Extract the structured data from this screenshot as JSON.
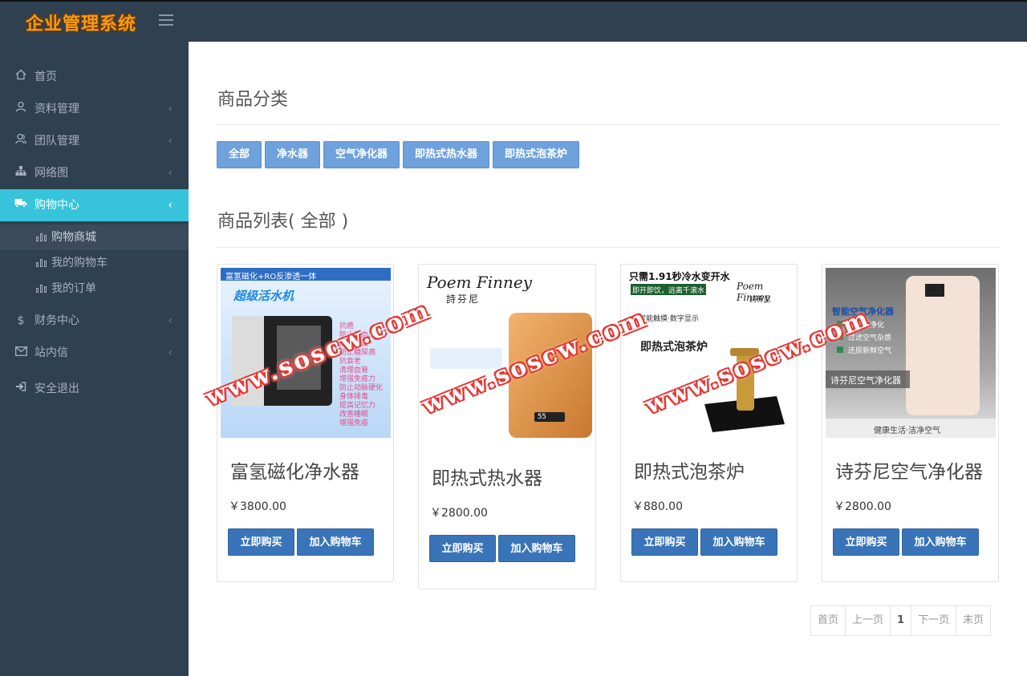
{
  "app": {
    "logo_text": "企业管理系统"
  },
  "sidebar": {
    "items": [
      {
        "label": "首页",
        "icon": "home-icon"
      },
      {
        "label": "资料管理",
        "icon": "user-icon"
      },
      {
        "label": "团队管理",
        "icon": "team-icon"
      },
      {
        "label": "网络图",
        "icon": "sitemap-icon"
      },
      {
        "label": "购物中心",
        "icon": "truck-icon",
        "active": true
      },
      {
        "label": "财务中心",
        "icon": "dollar-icon"
      },
      {
        "label": "站内信",
        "icon": "mail-icon"
      },
      {
        "label": "安全退出",
        "icon": "logout-icon"
      }
    ],
    "sub_items": [
      {
        "label": "购物商城",
        "active": true
      },
      {
        "label": "我的购物车"
      },
      {
        "label": "我的订单"
      }
    ]
  },
  "main": {
    "category_title": "商品分类",
    "categories": [
      "全部",
      "净水器",
      "空气净化器",
      "即热式热水器",
      "即热式泡茶炉"
    ],
    "list_title": "商品列表( 全部 )",
    "products": [
      {
        "name": "富氢磁化净水器",
        "price": "￥3800.00",
        "img_header": "富氢磁化+RO反渗透一体",
        "img_brand": "超级活水机",
        "img_features": [
          "抗癌",
          "防止高血压",
          "消除色斑",
          "防止糖尿病",
          "抗衰老",
          "清理血管",
          "增强免疫力",
          "防止动脉硬化",
          "身体排毒",
          "提高记忆力",
          "改善睡眠",
          "增强免疫"
        ]
      },
      {
        "name": "即热式热水器",
        "price": "￥2800.00",
        "img_brand": "Poem Finney",
        "img_brand_cn": "詩芬尼",
        "img_display": "55"
      },
      {
        "name": "即热式泡茶炉",
        "price": "￥880.00",
        "img_header": "只需1.91秒冷水变开水",
        "img_sub": "即开即饮，远离千滚水",
        "img_brand": "Poem Finney",
        "img_brand_cn": "詩芬尼",
        "img_feature": "智能触摸·数字显示",
        "img_product_title": "即热式泡茶炉"
      },
      {
        "name": "诗芬尼空气净化器",
        "price": "￥2800.00",
        "img_header": "智能空气净化器",
        "img_features": [
          "多元化净化",
          "过滤空气杂质",
          "还原新鲜空气"
        ],
        "img_label": "诗芬尼空气净化器",
        "img_footer": "健康生活·洁净空气"
      }
    ],
    "buy_now_label": "立即购买",
    "add_cart_label": "加入购物车",
    "pager": {
      "first": "首页",
      "prev": "上一页",
      "current": "1",
      "next": "下一页",
      "last": "末页"
    }
  },
  "watermark": "www.soscw.com",
  "colors": {
    "sidebar_bg": "#2f4050",
    "active_teal": "#37c3d9",
    "category_button": "#6fa1dd",
    "action_button": "#3a74b8"
  }
}
